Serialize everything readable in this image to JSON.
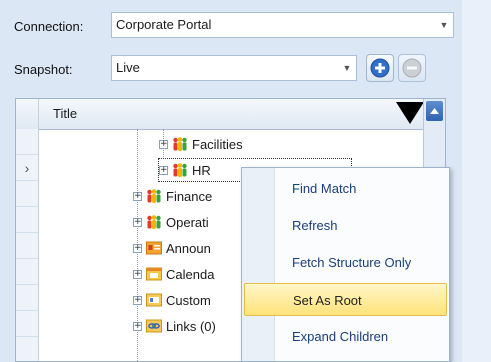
{
  "connection": {
    "label": "Connection:",
    "value": "Corporate Portal"
  },
  "snapshot": {
    "label": "Snapshot:",
    "value": "Live"
  },
  "buttons": {
    "add_icon": "plus-circle-icon",
    "remove_icon": "minus-circle-icon"
  },
  "grid": {
    "column_title": "Title",
    "items": [
      {
        "label": "Facilities",
        "icon": "people-group-icon"
      },
      {
        "label": "HR",
        "icon": "people-group-icon"
      },
      {
        "label": "Finance",
        "icon": "people-group-icon"
      },
      {
        "label": "Operati",
        "icon": "people-group-icon"
      },
      {
        "label": "Announ",
        "icon": "announcements-list-icon"
      },
      {
        "label": "Calenda",
        "icon": "calendar-list-icon"
      },
      {
        "label": "Custom",
        "icon": "custom-list-icon"
      },
      {
        "label": "Links (0)",
        "icon": "links-list-icon"
      }
    ]
  },
  "context_menu": {
    "items": [
      "Find Match",
      "Refresh",
      "Fetch Structure Only",
      "Set As Root",
      "Expand Children"
    ],
    "highlighted": "Set As Root"
  },
  "colors": {
    "accent": "#2d63b3",
    "highlight": "#ffe27a",
    "menu_text": "#1a3f7a"
  }
}
